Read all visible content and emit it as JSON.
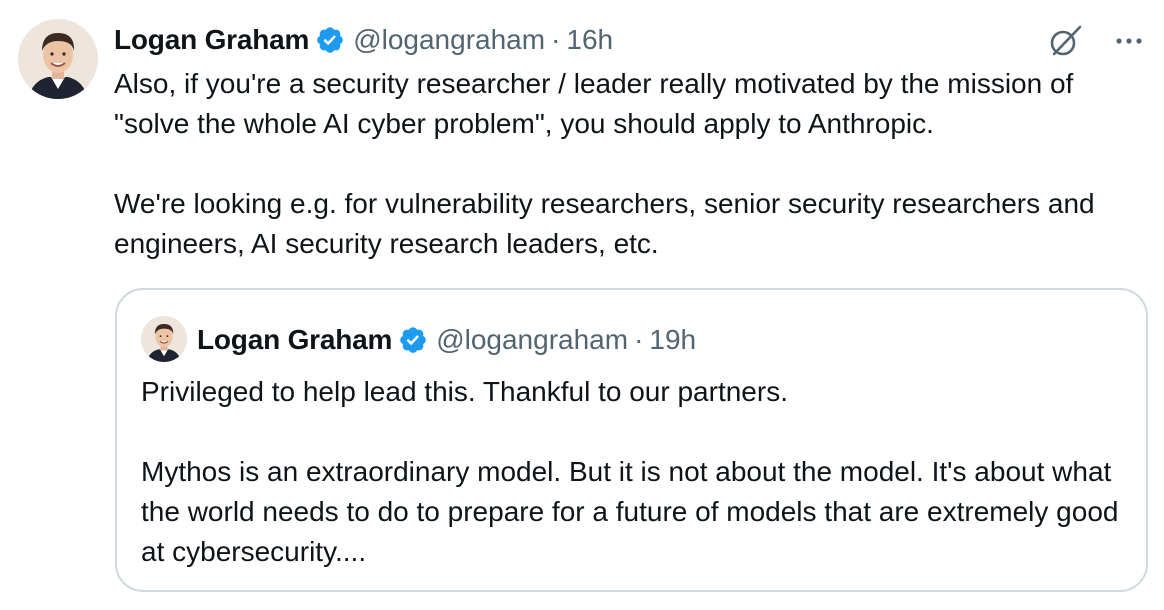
{
  "tweet": {
    "author_name": "Logan Graham",
    "handle": "@logangraham",
    "separator": "·",
    "time": "16h",
    "paragraphs": [
      "Also, if you're a security researcher / leader really motivated by the mission of \"solve the whole AI cyber problem\", you should apply to Anthropic.",
      "We're looking e.g. for vulnerability researchers, senior security researchers and engineers, AI security research leaders, etc."
    ],
    "icons": {
      "verified": "verified-badge-icon",
      "grok": "grok-icon",
      "more": "more-options-icon"
    }
  },
  "quoted_tweet": {
    "author_name": "Logan Graham",
    "handle": "@logangraham",
    "separator": "·",
    "time": "19h",
    "paragraphs": [
      "Privileged to help lead this. Thankful to our partners.",
      "Mythos is an extraordinary model. But it is not about the model. It's about what the world needs to do to prepare for a future of models that are extremely good at cybersecurity...."
    ]
  },
  "colors": {
    "text_primary": "#0f1419",
    "text_secondary": "#536471",
    "verified_blue": "#1d9bf0",
    "border": "#cfd9de"
  }
}
